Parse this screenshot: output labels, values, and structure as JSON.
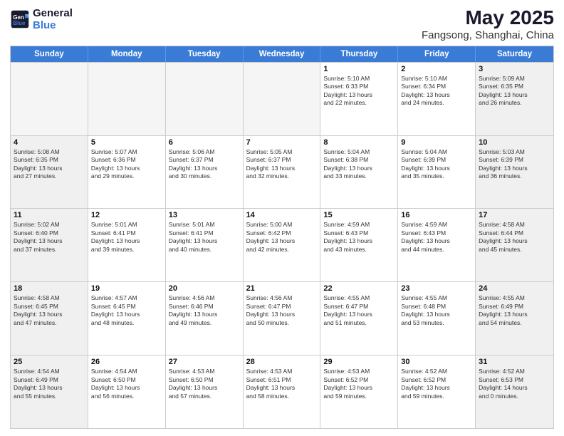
{
  "header": {
    "logo_line1": "General",
    "logo_line2": "Blue",
    "main_title": "May 2025",
    "subtitle": "Fangsong, Shanghai, China"
  },
  "cal_headers": [
    "Sunday",
    "Monday",
    "Tuesday",
    "Wednesday",
    "Thursday",
    "Friday",
    "Saturday"
  ],
  "weeks": [
    [
      {
        "day": "",
        "info": "",
        "empty": true
      },
      {
        "day": "",
        "info": "",
        "empty": true
      },
      {
        "day": "",
        "info": "",
        "empty": true
      },
      {
        "day": "",
        "info": "",
        "empty": true
      },
      {
        "day": "1",
        "info": "Sunrise: 5:10 AM\nSunset: 6:33 PM\nDaylight: 13 hours\nand 22 minutes.",
        "empty": false
      },
      {
        "day": "2",
        "info": "Sunrise: 5:10 AM\nSunset: 6:34 PM\nDaylight: 13 hours\nand 24 minutes.",
        "empty": false
      },
      {
        "day": "3",
        "info": "Sunrise: 5:09 AM\nSunset: 6:35 PM\nDaylight: 13 hours\nand 26 minutes.",
        "empty": false
      }
    ],
    [
      {
        "day": "4",
        "info": "Sunrise: 5:08 AM\nSunset: 6:35 PM\nDaylight: 13 hours\nand 27 minutes.",
        "empty": false
      },
      {
        "day": "5",
        "info": "Sunrise: 5:07 AM\nSunset: 6:36 PM\nDaylight: 13 hours\nand 29 minutes.",
        "empty": false
      },
      {
        "day": "6",
        "info": "Sunrise: 5:06 AM\nSunset: 6:37 PM\nDaylight: 13 hours\nand 30 minutes.",
        "empty": false
      },
      {
        "day": "7",
        "info": "Sunrise: 5:05 AM\nSunset: 6:37 PM\nDaylight: 13 hours\nand 32 minutes.",
        "empty": false
      },
      {
        "day": "8",
        "info": "Sunrise: 5:04 AM\nSunset: 6:38 PM\nDaylight: 13 hours\nand 33 minutes.",
        "empty": false
      },
      {
        "day": "9",
        "info": "Sunrise: 5:04 AM\nSunset: 6:39 PM\nDaylight: 13 hours\nand 35 minutes.",
        "empty": false
      },
      {
        "day": "10",
        "info": "Sunrise: 5:03 AM\nSunset: 6:39 PM\nDaylight: 13 hours\nand 36 minutes.",
        "empty": false
      }
    ],
    [
      {
        "day": "11",
        "info": "Sunrise: 5:02 AM\nSunset: 6:40 PM\nDaylight: 13 hours\nand 37 minutes.",
        "empty": false
      },
      {
        "day": "12",
        "info": "Sunrise: 5:01 AM\nSunset: 6:41 PM\nDaylight: 13 hours\nand 39 minutes.",
        "empty": false
      },
      {
        "day": "13",
        "info": "Sunrise: 5:01 AM\nSunset: 6:41 PM\nDaylight: 13 hours\nand 40 minutes.",
        "empty": false
      },
      {
        "day": "14",
        "info": "Sunrise: 5:00 AM\nSunset: 6:42 PM\nDaylight: 13 hours\nand 42 minutes.",
        "empty": false
      },
      {
        "day": "15",
        "info": "Sunrise: 4:59 AM\nSunset: 6:43 PM\nDaylight: 13 hours\nand 43 minutes.",
        "empty": false
      },
      {
        "day": "16",
        "info": "Sunrise: 4:59 AM\nSunset: 6:43 PM\nDaylight: 13 hours\nand 44 minutes.",
        "empty": false
      },
      {
        "day": "17",
        "info": "Sunrise: 4:58 AM\nSunset: 6:44 PM\nDaylight: 13 hours\nand 45 minutes.",
        "empty": false
      }
    ],
    [
      {
        "day": "18",
        "info": "Sunrise: 4:58 AM\nSunset: 6:45 PM\nDaylight: 13 hours\nand 47 minutes.",
        "empty": false
      },
      {
        "day": "19",
        "info": "Sunrise: 4:57 AM\nSunset: 6:45 PM\nDaylight: 13 hours\nand 48 minutes.",
        "empty": false
      },
      {
        "day": "20",
        "info": "Sunrise: 4:56 AM\nSunset: 6:46 PM\nDaylight: 13 hours\nand 49 minutes.",
        "empty": false
      },
      {
        "day": "21",
        "info": "Sunrise: 4:56 AM\nSunset: 6:47 PM\nDaylight: 13 hours\nand 50 minutes.",
        "empty": false
      },
      {
        "day": "22",
        "info": "Sunrise: 4:55 AM\nSunset: 6:47 PM\nDaylight: 13 hours\nand 51 minutes.",
        "empty": false
      },
      {
        "day": "23",
        "info": "Sunrise: 4:55 AM\nSunset: 6:48 PM\nDaylight: 13 hours\nand 53 minutes.",
        "empty": false
      },
      {
        "day": "24",
        "info": "Sunrise: 4:55 AM\nSunset: 6:49 PM\nDaylight: 13 hours\nand 54 minutes.",
        "empty": false
      }
    ],
    [
      {
        "day": "25",
        "info": "Sunrise: 4:54 AM\nSunset: 6:49 PM\nDaylight: 13 hours\nand 55 minutes.",
        "empty": false
      },
      {
        "day": "26",
        "info": "Sunrise: 4:54 AM\nSunset: 6:50 PM\nDaylight: 13 hours\nand 56 minutes.",
        "empty": false
      },
      {
        "day": "27",
        "info": "Sunrise: 4:53 AM\nSunset: 6:50 PM\nDaylight: 13 hours\nand 57 minutes.",
        "empty": false
      },
      {
        "day": "28",
        "info": "Sunrise: 4:53 AM\nSunset: 6:51 PM\nDaylight: 13 hours\nand 58 minutes.",
        "empty": false
      },
      {
        "day": "29",
        "info": "Sunrise: 4:53 AM\nSunset: 6:52 PM\nDaylight: 13 hours\nand 59 minutes.",
        "empty": false
      },
      {
        "day": "30",
        "info": "Sunrise: 4:52 AM\nSunset: 6:52 PM\nDaylight: 13 hours\nand 59 minutes.",
        "empty": false
      },
      {
        "day": "31",
        "info": "Sunrise: 4:52 AM\nSunset: 6:53 PM\nDaylight: 14 hours\nand 0 minutes.",
        "empty": false
      }
    ]
  ]
}
